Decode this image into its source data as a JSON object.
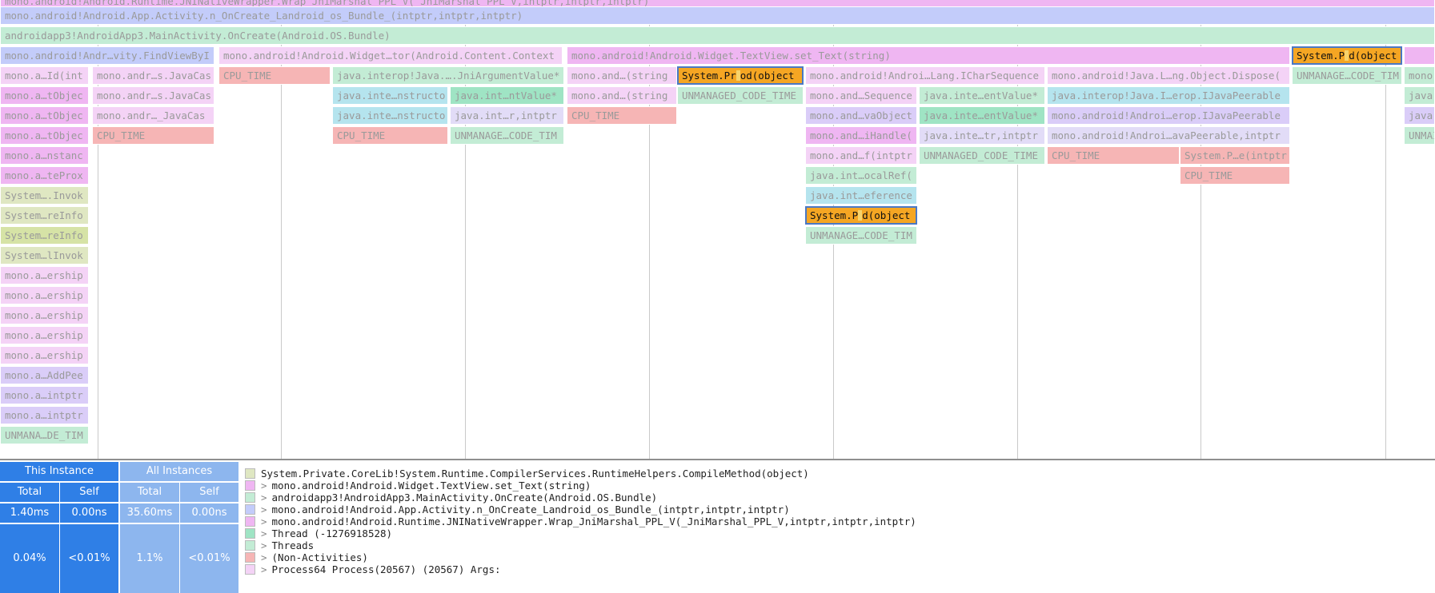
{
  "colors": {
    "pink": "#efb6f2",
    "pink_light": "#f4d3f6",
    "blue": "#c3ccfa",
    "green": "#c3ecd5",
    "green_mid": "#9fe4c4",
    "cyan": "#b5e4ee",
    "red": "#f6b5b5",
    "purple": "#dacdf8",
    "lavender": "#e2dcf7",
    "olive": "#dfe7c2",
    "olive_dark": "#d6e3a6",
    "orange": "#f5a623",
    "stats_dark": "#2f7fe6",
    "stats_light": "#8db6ee"
  },
  "flamegraph": {
    "frames": [
      {
        "label": "mono.android!Android.App.Activity.n_OnCreate_Landroid_os_Bundle_(intptr,intptr,intptr)",
        "color": "blue",
        "hl": false
      },
      {
        "label": "androidapp3!AndroidApp3.MainActivity.OnCreate(Android.OS.Bundle)",
        "color": "green",
        "hl": false
      },
      {
        "label": "mono.android!Andr…vity.FindViewByI",
        "color": "blue",
        "hl": false
      },
      {
        "label": "mono.android!Android.Widget…tor(Android.Content.Context",
        "color": "pink_light",
        "hl": false
      },
      {
        "label": "mono.android!Android.Widget.TextView.set_Text(string)",
        "color": "pink",
        "hl": false
      },
      {
        "label": "System.P…d(object",
        "color": "orange",
        "hl": true
      },
      {
        "label": "",
        "color": "pink",
        "hl": false
      },
      {
        "label": "mono.a…Id(int",
        "color": "pink_light",
        "hl": false
      },
      {
        "label": "mono.andr…s.JavaCas",
        "color": "pink_light",
        "hl": false
      },
      {
        "label": "CPU_TIME",
        "color": "red",
        "hl": false
      },
      {
        "label": "java.interop!Java.….JniArgumentValue*",
        "color": "green",
        "hl": false
      },
      {
        "label": "mono.and…(string",
        "color": "pink_light",
        "hl": false
      },
      {
        "label": "System.Pr…od(object",
        "color": "orange",
        "hl": true
      },
      {
        "label": "mono.android!Androi…Lang.ICharSequence",
        "color": "pink_light",
        "hl": false
      },
      {
        "label": "mono.android!Java.L…ng.Object.Dispose(",
        "color": "pink_light",
        "hl": false
      },
      {
        "label": "UNMANAGE…CODE_TIM",
        "color": "green",
        "hl": false
      },
      {
        "label": "mono.a",
        "color": "green",
        "hl": false
      },
      {
        "label": "mono.a…tObjec",
        "color": "pink",
        "hl": false
      },
      {
        "label": "mono.andr…s.JavaCas",
        "color": "pink_light",
        "hl": false
      },
      {
        "label": "java.inte…nstructo",
        "color": "cyan",
        "hl": false
      },
      {
        "label": "java.int…ntValue*",
        "color": "green_mid",
        "hl": false
      },
      {
        "label": "mono.and…(string",
        "color": "pink_light",
        "hl": false
      },
      {
        "label": "UNMANAGED_CODE_TIME",
        "color": "green",
        "hl": false
      },
      {
        "label": "mono.and…Sequence",
        "color": "pink_light",
        "hl": false
      },
      {
        "label": "java.inte…entValue*",
        "color": "green",
        "hl": false
      },
      {
        "label": "java.interop!Java.I…erop.IJavaPeerable",
        "color": "cyan",
        "hl": false
      },
      {
        "label": "java",
        "color": "green",
        "hl": false
      },
      {
        "label": "mono.a…tObjec",
        "color": "pink",
        "hl": false
      },
      {
        "label": "mono.andr…_JavaCas",
        "color": "pink_light",
        "hl": false
      },
      {
        "label": "java.inte…nstructo",
        "color": "cyan",
        "hl": false
      },
      {
        "label": "java.int…r,intptr",
        "color": "lavender",
        "hl": false
      },
      {
        "label": "CPU_TIME",
        "color": "red",
        "hl": false
      },
      {
        "label": "mono.and…vaObject",
        "color": "purple",
        "hl": false
      },
      {
        "label": "java.inte…entValue*",
        "color": "green_mid",
        "hl": false
      },
      {
        "label": "mono.android!Androi…erop.IJavaPeerable",
        "color": "purple",
        "hl": false
      },
      {
        "label": "java",
        "color": "purple",
        "hl": false
      },
      {
        "label": "mono.a…tObjec",
        "color": "pink",
        "hl": false
      },
      {
        "label": "CPU_TIME",
        "color": "red",
        "hl": false
      },
      {
        "label": "CPU_TIME",
        "color": "red",
        "hl": false
      },
      {
        "label": "UNMANAGE…CODE_TIM",
        "color": "green",
        "hl": false
      },
      {
        "label": "mono.and…iHandle(",
        "color": "pink",
        "hl": false
      },
      {
        "label": "java.inte…tr,intptr",
        "color": "lavender",
        "hl": false
      },
      {
        "label": "mono.android!Androi…avaPeerable,intptr",
        "color": "lavender",
        "hl": false
      },
      {
        "label": "UNMAI",
        "color": "green",
        "hl": false
      },
      {
        "label": "mono.a…nstanc",
        "color": "pink",
        "hl": false
      },
      {
        "label": "mono.and…f(intptr",
        "color": "pink_light",
        "hl": false
      },
      {
        "label": "UNMANAGED_CODE_TIME",
        "color": "green",
        "hl": false
      },
      {
        "label": "CPU_TIME",
        "color": "red",
        "hl": false
      },
      {
        "label": "System.P…e(intptr",
        "color": "red",
        "hl": false
      },
      {
        "label": "mono.a…teProx",
        "color": "pink",
        "hl": false
      },
      {
        "label": "java.int…ocalRef(",
        "color": "green",
        "hl": false
      },
      {
        "label": "CPU_TIME",
        "color": "red",
        "hl": false
      },
      {
        "label": "System….Invok",
        "color": "olive",
        "hl": false
      },
      {
        "label": "java.int…eference",
        "color": "cyan",
        "hl": false
      },
      {
        "label": "System…reInfo",
        "color": "olive",
        "hl": false
      },
      {
        "label": "System.P…d(object",
        "color": "orange",
        "hl": true
      },
      {
        "label": "System…reInfo",
        "color": "olive_dark",
        "hl": false
      },
      {
        "label": "UNMANAGE…CODE_TIM",
        "color": "green",
        "hl": false
      },
      {
        "label": "System…lInvok",
        "color": "olive",
        "hl": false
      },
      {
        "label": "mono.a…ership",
        "color": "pink_light",
        "hl": false
      },
      {
        "label": "mono.a…ership",
        "color": "pink_light",
        "hl": false
      },
      {
        "label": "mono.a…ership",
        "color": "pink_light",
        "hl": false
      },
      {
        "label": "mono.a…ership",
        "color": "pink_light",
        "hl": false
      },
      {
        "label": "mono.a…ership",
        "color": "pink_light",
        "hl": false
      },
      {
        "label": "mono.a…AddPee",
        "color": "purple",
        "hl": false
      },
      {
        "label": "mono.a…intptr",
        "color": "purple",
        "hl": false
      },
      {
        "label": "mono.a…intptr",
        "color": "purple",
        "hl": false
      },
      {
        "label": "UNMANA…DE_TIM",
        "color": "green",
        "hl": false
      },
      {
        "label": "mono.android!Android.Runtime.JNINativeWrapper.Wrap_JniMarshal_PPL_V(_JniMarshal_PPL_V,intptr,intptr,intptr)",
        "color": "pink",
        "hl": false
      }
    ]
  },
  "stats": {
    "this_instance": "This Instance",
    "all_instances": "All Instances",
    "total_label": "Total",
    "self_label": "Self",
    "this_total": "1.40ms",
    "this_self": "0.00ns",
    "all_total": "35.60ms",
    "all_self": "0.00ns",
    "this_total_pct": "0.04%",
    "this_self_pct": "<0.01%",
    "all_total_pct": "1.1%",
    "all_self_pct": "<0.01%"
  },
  "stack": {
    "chevron": ">",
    "rows": [
      {
        "label": "System.Private.CoreLib!System.Runtime.CompilerServices.RuntimeHelpers.CompileMethod(object)",
        "color": "olive",
        "chevron": false
      },
      {
        "label": "mono.android!Android.Widget.TextView.set_Text(string)",
        "color": "pink",
        "chevron": true
      },
      {
        "label": "androidapp3!AndroidApp3.MainActivity.OnCreate(Android.OS.Bundle)",
        "color": "green",
        "chevron": true
      },
      {
        "label": "mono.android!Android.App.Activity.n_OnCreate_Landroid_os_Bundle_(intptr,intptr,intptr)",
        "color": "blue",
        "chevron": true
      },
      {
        "label": "mono.android!Android.Runtime.JNINativeWrapper.Wrap_JniMarshal_PPL_V(_JniMarshal_PPL_V,intptr,intptr,intptr)",
        "color": "pink",
        "chevron": true
      },
      {
        "label": "Thread (-1276918528)",
        "color": "green_mid",
        "chevron": true
      },
      {
        "label": "Threads",
        "color": "green",
        "chevron": true
      },
      {
        "label": "(Non-Activities)",
        "color": "red",
        "chevron": true
      },
      {
        "label": "Process64 Process(20567) (20567) Args:",
        "color": "pink_light",
        "chevron": true
      }
    ]
  }
}
